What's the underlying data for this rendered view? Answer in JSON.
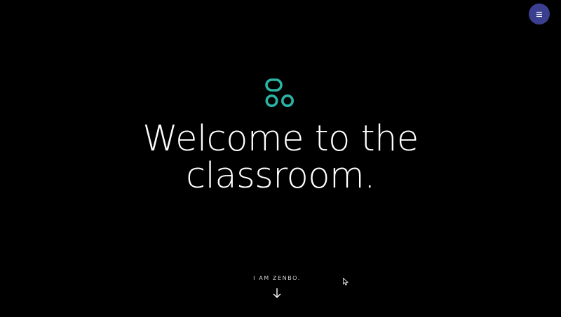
{
  "header": {
    "menu_icon": "hamburger-menu-icon"
  },
  "logo": {
    "icon": "three-rings-logo-icon",
    "color": "#2bb3a3"
  },
  "hero": {
    "title_line1": "Welcome to the",
    "title_line2": "classroom."
  },
  "scroll_cue": {
    "label": "I AM ZENBO.",
    "icon": "arrow-down-icon"
  },
  "colors": {
    "background": "#000000",
    "menu_button": "#3b3f8f",
    "text": "#ffffff",
    "accent": "#2bb3a3"
  }
}
